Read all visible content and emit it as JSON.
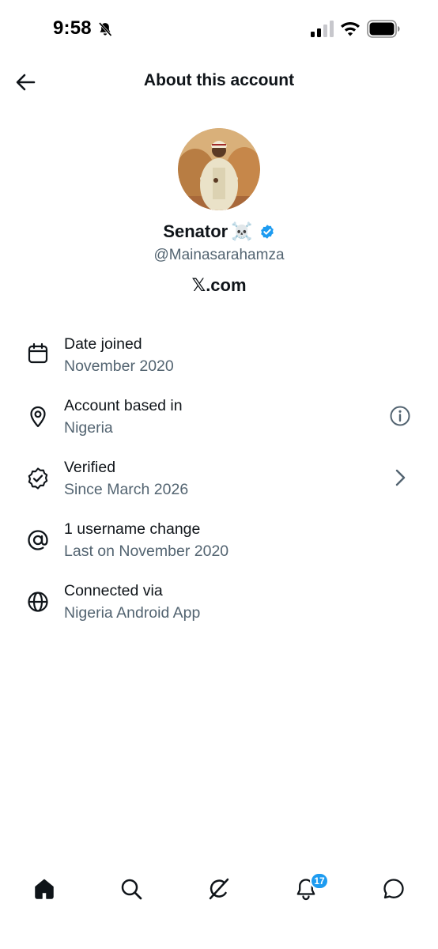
{
  "status_bar": {
    "time": "9:58"
  },
  "header": {
    "title": "About this account"
  },
  "profile": {
    "display_name": "Senator",
    "name_emoji": "☠️",
    "handle": "@Mainasarahamza",
    "source_logo": "𝕏",
    "source_text": ".com",
    "verified_color": "#1d9bf0"
  },
  "info_items": [
    {
      "icon": "calendar-icon",
      "title": "Date joined",
      "subtitle": "November 2020"
    },
    {
      "icon": "location-pin-icon",
      "title": "Account based in",
      "subtitle": "Nigeria",
      "trailing_icon": "info-icon"
    },
    {
      "icon": "verified-outline-icon",
      "title": "Verified",
      "subtitle": "Since March 2026",
      "trailing_icon": "chevron-right-icon"
    },
    {
      "icon": "at-sign-icon",
      "title": "1 username change",
      "subtitle": "Last on November 2020"
    },
    {
      "icon": "globe-icon",
      "title": "Connected via",
      "subtitle": "Nigeria Android App"
    }
  ],
  "bottom_nav": {
    "items": [
      "home-icon",
      "search-icon",
      "grok-icon",
      "notifications-icon",
      "messages-icon"
    ],
    "notification_count": "17"
  },
  "colors": {
    "text_primary": "#0f1419",
    "text_secondary": "#536471",
    "accent": "#1d9bf0"
  }
}
